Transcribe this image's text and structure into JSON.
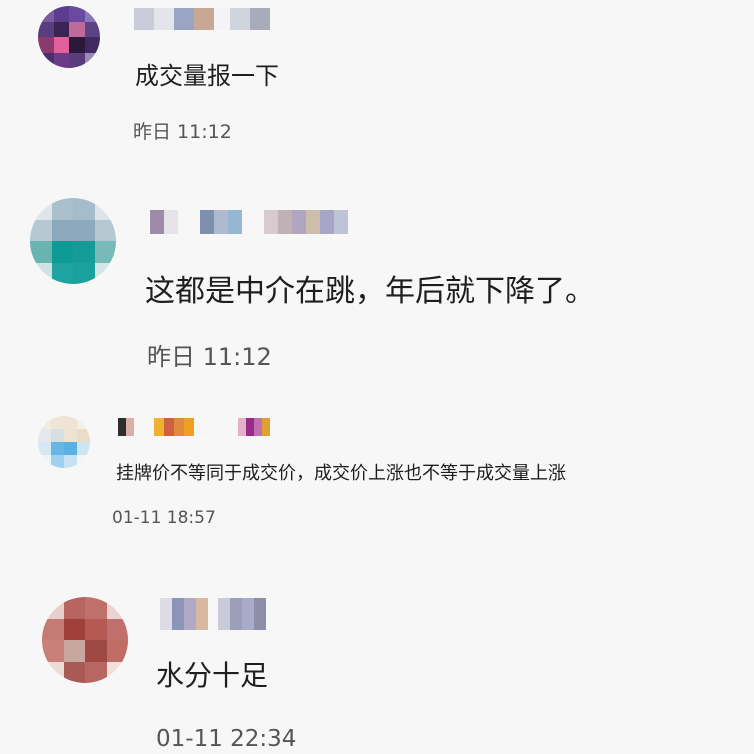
{
  "comments": [
    {
      "text": "成交量报一下",
      "time": "昨日 11:12"
    },
    {
      "text": "这都是中介在跳，年后就下降了。",
      "time": "昨日 11:12"
    },
    {
      "text": "挂牌价不等同于成交价，成交价上涨也不等于成交量上涨",
      "time": "01-11 18:57"
    },
    {
      "text": "水分十足",
      "time": "01-11 22:34"
    }
  ]
}
